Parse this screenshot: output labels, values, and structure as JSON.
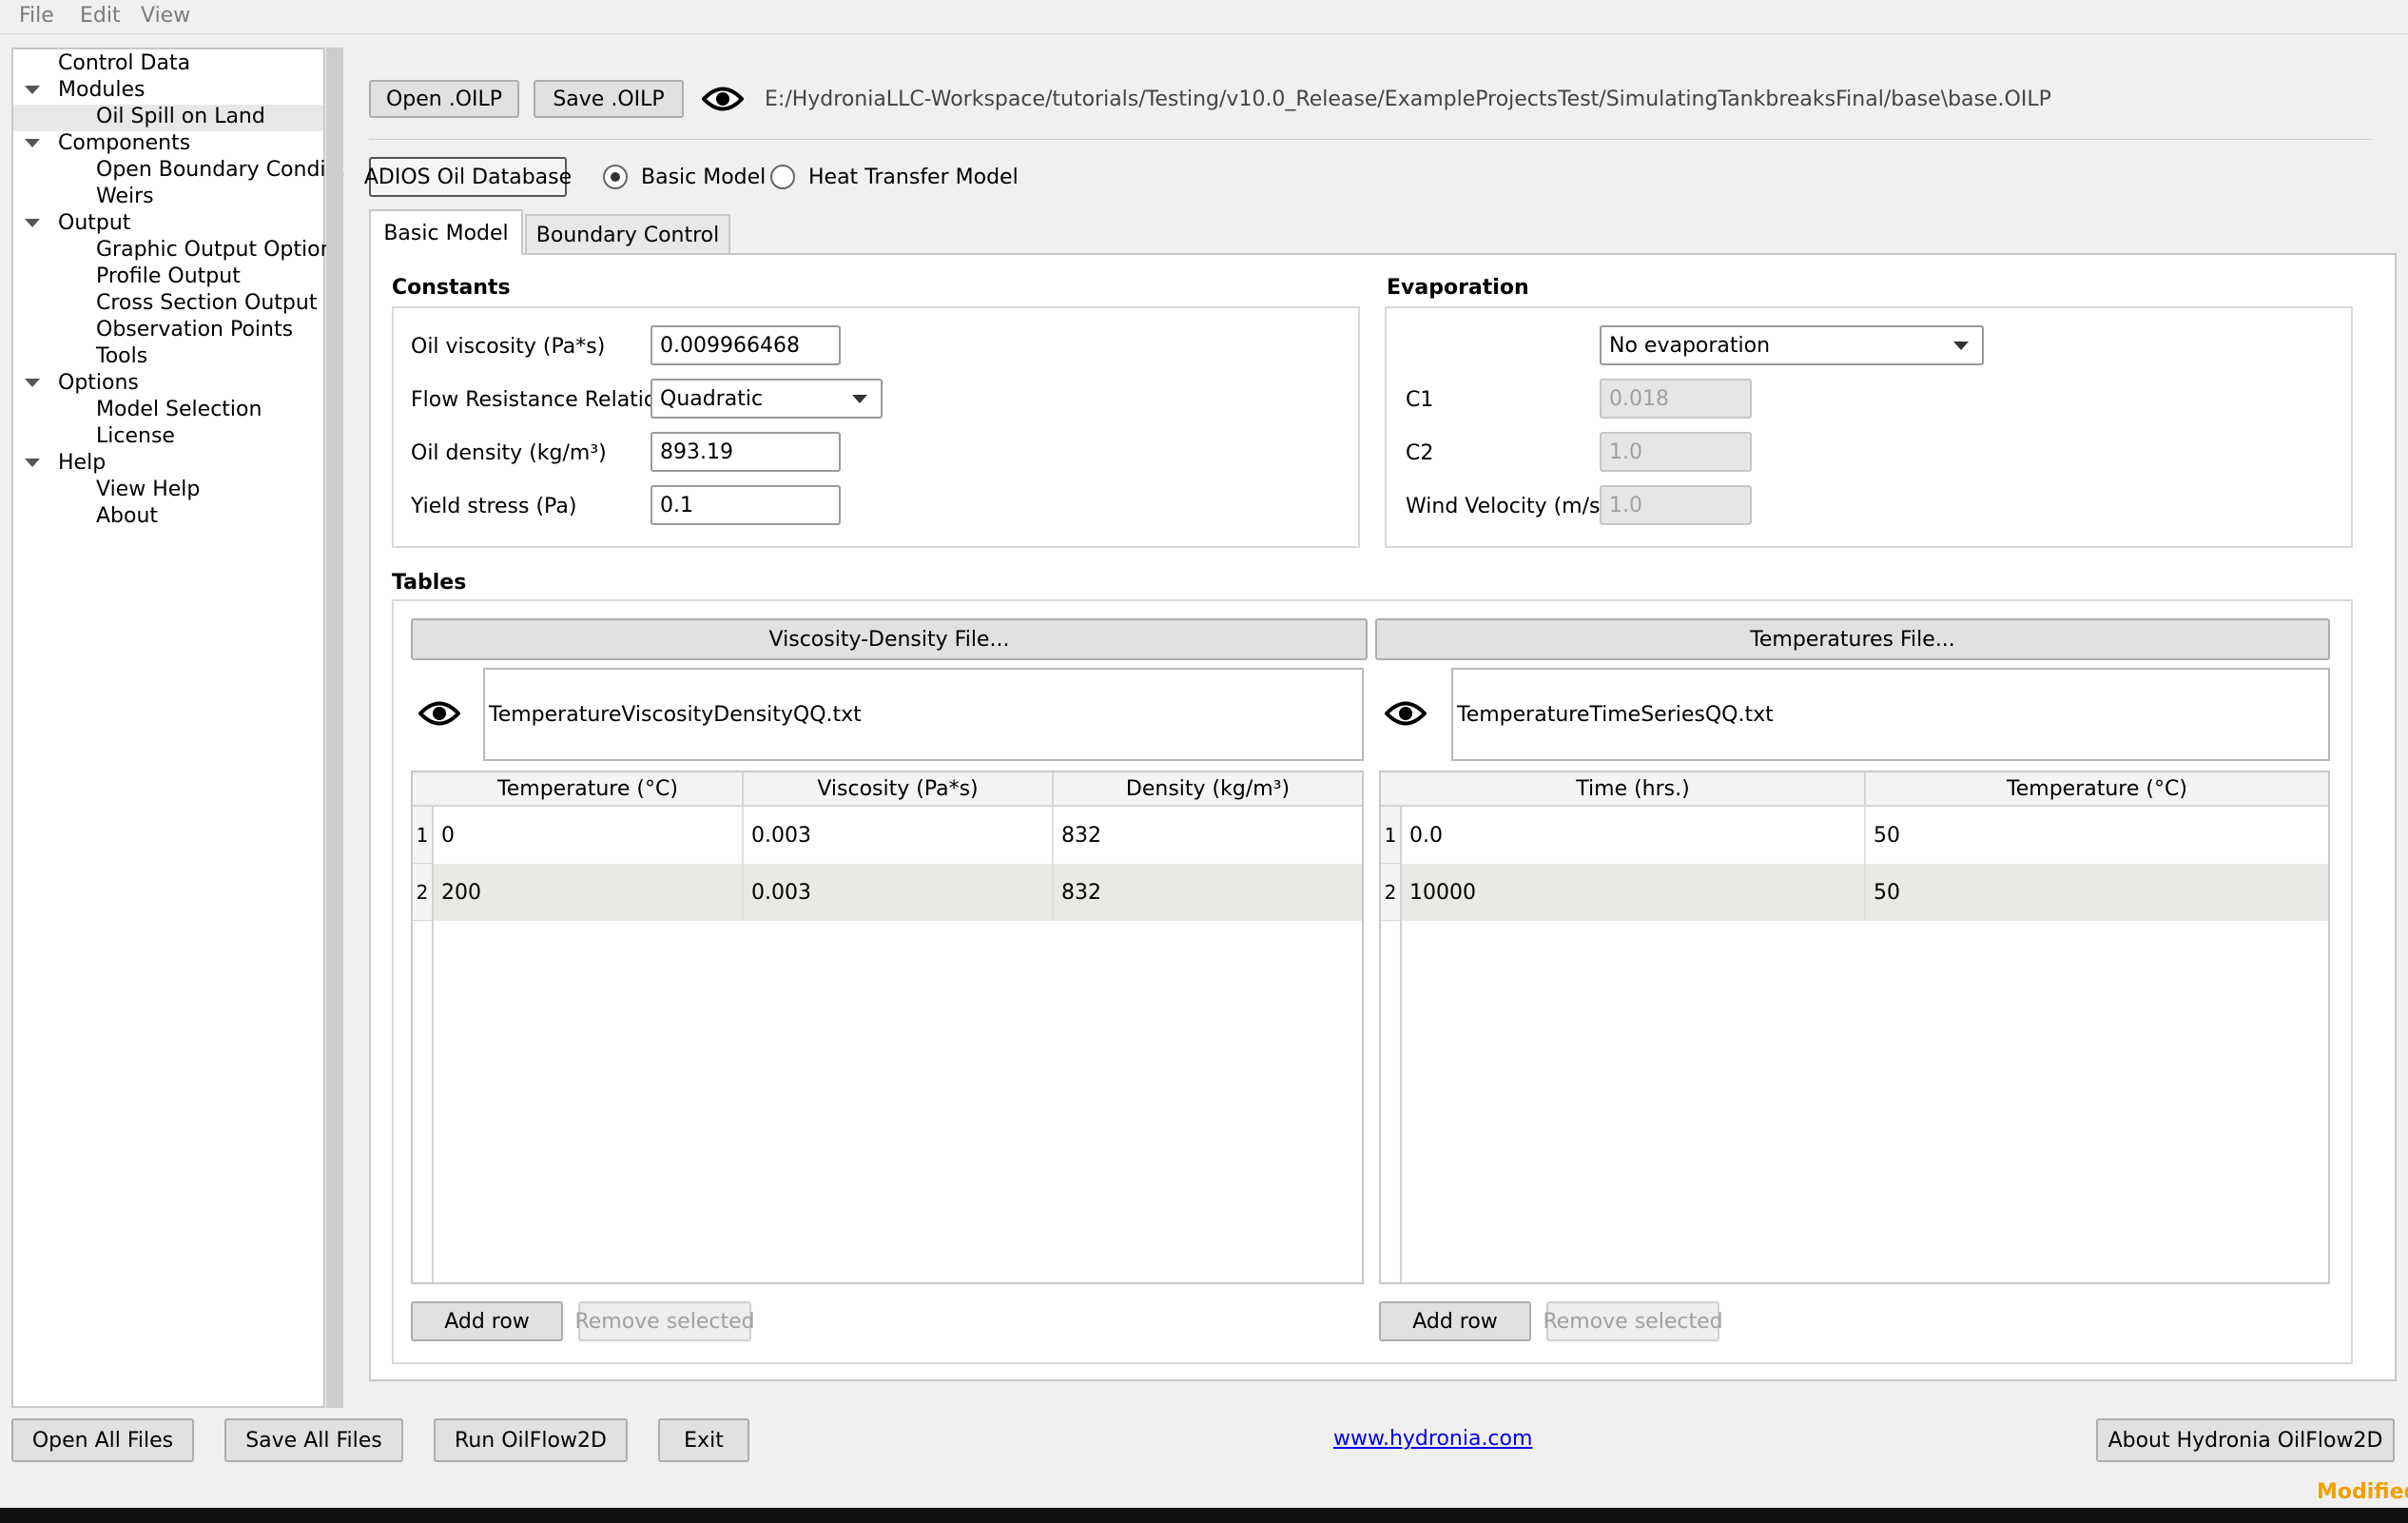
{
  "menu": {
    "file": "File",
    "edit": "Edit",
    "view": "View"
  },
  "tree": {
    "control_data": "Control Data",
    "modules": "Modules",
    "oil_spill": "Oil Spill on Land",
    "components": "Components",
    "open_boundary": "Open Boundary Condi...",
    "weirs": "Weirs",
    "output": "Output",
    "graphic_output": "Graphic Output Options",
    "profile_output": "Profile Output",
    "cross_section": "Cross Section Output",
    "observation_points": "Observation Points",
    "tools": "Tools",
    "options": "Options",
    "model_selection": "Model Selection",
    "license": "License",
    "help": "Help",
    "view_help": "View Help",
    "about": "About"
  },
  "top": {
    "open_btn": "Open .OILP",
    "save_btn": "Save .OILP",
    "file_path": "E:/HydroniaLLC-Workspace/tutorials/Testing/v10.0_Release/ExampleProjectsTest/SimulatingTankbreaksFinal/base\\base.OILP",
    "adios_btn": "ADIOS Oil Database",
    "radio_basic": "Basic Model",
    "radio_heat": "Heat Transfer Model",
    "selected_model": "basic"
  },
  "tabs": {
    "basic": "Basic Model",
    "boundary": "Boundary Control"
  },
  "constants": {
    "title": "Constants",
    "viscosity_label": "Oil viscosity (Pa*s)",
    "viscosity_value": "0.009966468",
    "flow_label": "Flow Resistance Relation",
    "flow_value": "Quadratic",
    "density_label": "Oil density (kg/m³)",
    "density_value": "893.19",
    "yield_label": "Yield stress (Pa)",
    "yield_value": "0.1"
  },
  "evaporation": {
    "title": "Evaporation",
    "mode": "No evaporation",
    "c1_label": "C1",
    "c1_value": "0.018",
    "c2_label": "C2",
    "c2_value": "1.0",
    "wind_label": "Wind Velocity (m/s)",
    "wind_value": "1.0"
  },
  "tables": {
    "title": "Tables",
    "visc_file_btn": "Viscosity-Density File...",
    "visc_file_name": "TemperatureViscosityDensityQQ.txt",
    "visc_headers": [
      "Temperature (°C)",
      "Viscosity (Pa*s)",
      "Density (kg/m³)"
    ],
    "visc_rows": [
      {
        "n": "1",
        "c": [
          "0",
          "0.003",
          "832"
        ]
      },
      {
        "n": "2",
        "c": [
          "200",
          "0.003",
          "832"
        ]
      }
    ],
    "temp_file_btn": "Temperatures File...",
    "temp_file_name": "TemperatureTimeSeriesQQ.txt",
    "temp_headers": [
      "Time (hrs.)",
      "Temperature (°C)"
    ],
    "temp_rows": [
      {
        "n": "1",
        "c": [
          "0.0",
          "50"
        ]
      },
      {
        "n": "2",
        "c": [
          "10000",
          "50"
        ]
      }
    ],
    "add_row": "Add row",
    "remove_selected": "Remove selected"
  },
  "footer": {
    "open_all": "Open All Files",
    "save_all": "Save All Files",
    "run": "Run OilFlow2D",
    "exit": "Exit",
    "link": "www.hydronia.com",
    "about": "About Hydronia OilFlow2D",
    "status": "Modified"
  },
  "colors": {
    "status": "#f0a000",
    "link": "#0000ee",
    "row_alt": "#e9e9e6"
  }
}
